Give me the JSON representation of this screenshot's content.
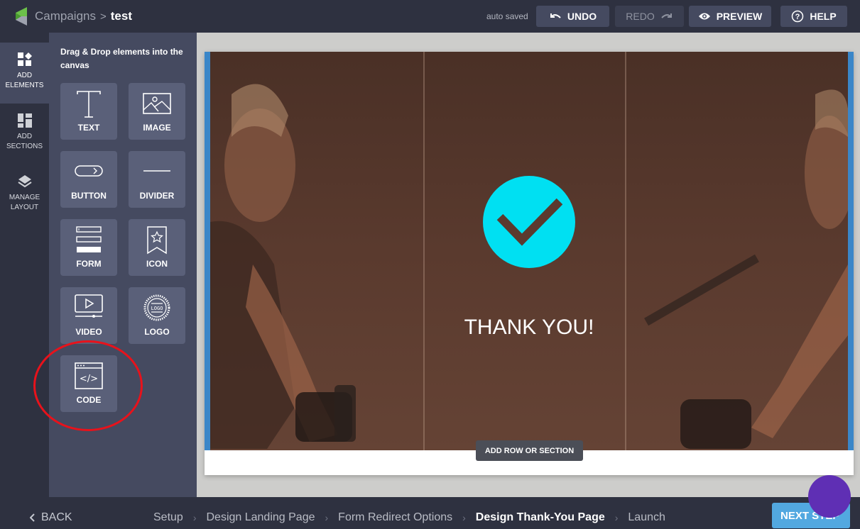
{
  "header": {
    "breadcrumb_parent": "Campaigns",
    "breadcrumb_separator": ">",
    "breadcrumb_current": "test",
    "autosave_status": "auto saved",
    "buttons": {
      "undo": "UNDO",
      "redo": "REDO",
      "preview": "PREVIEW",
      "help": "HELP"
    }
  },
  "rail": {
    "items": [
      {
        "line1": "ADD",
        "line2": "ELEMENTS",
        "icon": "add-elements-icon",
        "active": true
      },
      {
        "line1": "ADD",
        "line2": "SECTIONS",
        "icon": "add-sections-icon",
        "active": false
      },
      {
        "line1": "MANAGE",
        "line2": "LAYOUT",
        "icon": "layers-icon",
        "active": false
      }
    ]
  },
  "panel": {
    "title": "Drag & Drop elements into the canvas",
    "tiles": [
      {
        "label": "TEXT",
        "icon": "text-icon"
      },
      {
        "label": "IMAGE",
        "icon": "image-icon"
      },
      {
        "label": "BUTTON",
        "icon": "button-icon"
      },
      {
        "label": "DIVIDER",
        "icon": "divider-icon"
      },
      {
        "label": "FORM",
        "icon": "form-icon"
      },
      {
        "label": "ICON",
        "icon": "bookmark-star-icon"
      },
      {
        "label": "VIDEO",
        "icon": "video-icon"
      },
      {
        "label": "LOGO",
        "icon": "logo-badge-icon"
      },
      {
        "label": "CODE",
        "icon": "code-icon"
      }
    ],
    "logo_badge_text": "LOGO",
    "code_glyph": "</>"
  },
  "canvas": {
    "heading": "THANK YOU!",
    "add_row_label": "ADD ROW OR SECTION",
    "colors": {
      "check_circle": "#00e0f2",
      "selection_edge": "#3a86c8"
    }
  },
  "footer": {
    "back_label": "BACK",
    "steps": [
      {
        "label": "Setup",
        "active": false
      },
      {
        "label": "Design Landing Page",
        "active": false
      },
      {
        "label": "Form Redirect Options",
        "active": false
      },
      {
        "label": "Design Thank-You Page",
        "active": true
      },
      {
        "label": "Launch",
        "active": false
      }
    ],
    "step_separator": "›",
    "next_label": "NEXT STEP"
  },
  "annotation": {
    "highlight_color": "#e8121b",
    "highlighted_tile": "CODE"
  }
}
